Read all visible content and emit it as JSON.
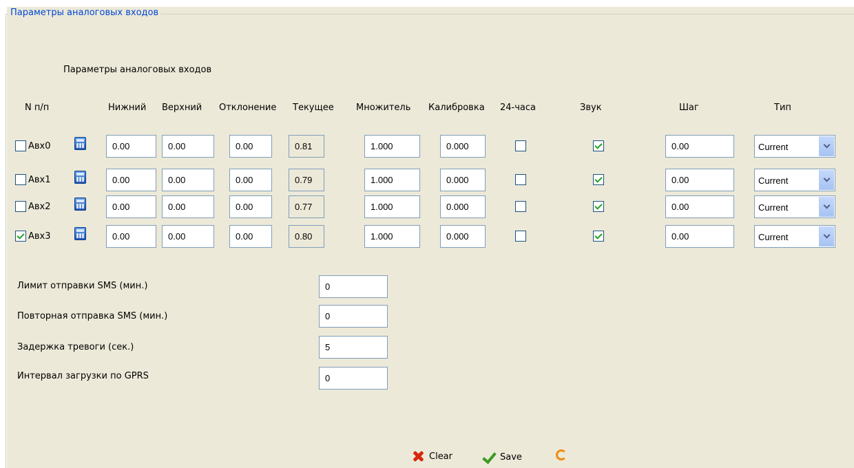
{
  "legend": "Параметры аналоговых входов",
  "subtitle": "Параметры аналоговых входов",
  "headers": {
    "num": "N п/п",
    "lower": "Нижний",
    "upper": "Верхний",
    "deviation": "Отклонение",
    "current": "Текущее",
    "multiplier": "Множитель",
    "calibration": "Калибровка",
    "h24": "24-часа",
    "sound": "Звук",
    "step": "Шаг",
    "type": "Тип"
  },
  "rows": [
    {
      "name": "Авх0",
      "enabled": false,
      "lower": "0.00",
      "upper": "0.00",
      "deviation": "0.00",
      "current": "0.81",
      "multiplier": "1.000",
      "calibration": "0.000",
      "h24": false,
      "sound": true,
      "step": "0.00",
      "type": "Current"
    },
    {
      "name": "Авх1",
      "enabled": false,
      "lower": "0.00",
      "upper": "0.00",
      "deviation": "0.00",
      "current": "0.79",
      "multiplier": "1.000",
      "calibration": "0.000",
      "h24": false,
      "sound": true,
      "step": "0.00",
      "type": "Current"
    },
    {
      "name": "Авх2",
      "enabled": false,
      "lower": "0.00",
      "upper": "0.00",
      "deviation": "0.00",
      "current": "0.77",
      "multiplier": "1.000",
      "calibration": "0.000",
      "h24": false,
      "sound": true,
      "step": "0.00",
      "type": "Current"
    },
    {
      "name": "Авх3",
      "enabled": true,
      "lower": "0.00",
      "upper": "0.00",
      "deviation": "0.00",
      "current": "0.80",
      "multiplier": "1.000",
      "calibration": "0.000",
      "h24": false,
      "sound": true,
      "step": "0.00",
      "type": "Current"
    }
  ],
  "settings": {
    "sms_limit_label": "Лимит отправки SMS (мин.)",
    "sms_limit_value": "0",
    "sms_repeat_label": "Повторная отправка SMS (мин.)",
    "sms_repeat_value": "0",
    "alarm_delay_label": "Задержка тревоги (сек.)",
    "alarm_delay_value": "5",
    "gprs_interval_label": "Интервал загрузки по GPRS",
    "gprs_interval_value": "0"
  },
  "buttons": {
    "clear": "Clear",
    "save": "Save"
  },
  "icons": {
    "clear": "red-x-icon",
    "save": "green-check-icon",
    "refresh": "refresh-icon",
    "calculator": "calculator-icon"
  }
}
